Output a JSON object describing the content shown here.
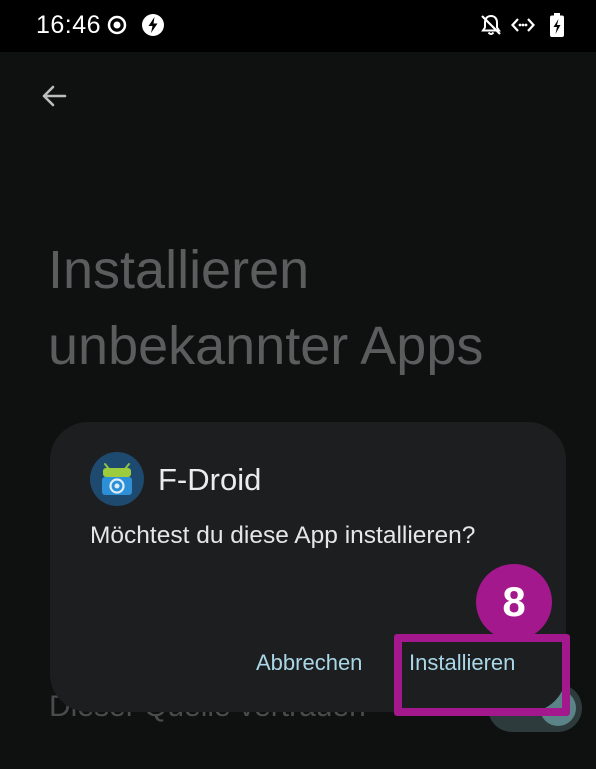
{
  "status_bar": {
    "time": "16:46",
    "icons": [
      "record-icon",
      "bolt-icon",
      "bell-off-icon",
      "code-icon",
      "battery-charging-icon"
    ]
  },
  "header": {
    "back_icon": "arrow-left-icon"
  },
  "page": {
    "title": "Installieren unbekannter Apps",
    "trust_toggle": {
      "label": "Dieser Quelle vertrauen",
      "state": "on"
    }
  },
  "dialog": {
    "app_icon": "f-droid-icon",
    "app_name": "F-Droid",
    "message": "Möchtest du diese App installieren?",
    "cancel_label": "Abbrechen",
    "install_label": "Installieren"
  },
  "annotation": {
    "step_number": "8",
    "color": "#a3188c"
  },
  "colors": {
    "background": "#0f1010",
    "dialog": "#1d1e1f",
    "button_text": "#a9d7e8"
  }
}
